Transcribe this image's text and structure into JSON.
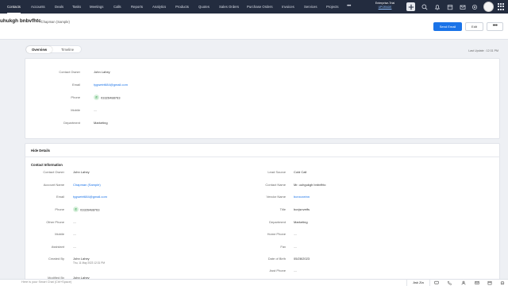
{
  "nav": {
    "tabs": [
      "Contacts",
      "Accounts",
      "Deals",
      "Tasks",
      "Meetings",
      "Calls",
      "Reports",
      "Analytics",
      "Products",
      "Quotes",
      "Sales Orders",
      "Purchase Orders",
      "Invoices",
      "Services",
      "Projects"
    ],
    "more": "•••",
    "plan_name": "Enterprise-Trial",
    "upgrade": "UPGRADE",
    "icons": [
      "plus-icon",
      "search-icon",
      "bell-icon",
      "calendar-icon",
      "mail-icon",
      "settings-icon",
      "gear-icon",
      "avatar",
      "apps-grid-icon"
    ]
  },
  "record": {
    "name": "uhukgh bnbvfhtc",
    "subtitle": "- Chapman (Sample)",
    "send_email": "Send Email",
    "edit": "Edit",
    "more": "•••"
  },
  "tabs": {
    "overview": "Overview",
    "timeline": "Timeline"
  },
  "last_update": "Last Update : 12:31 PM",
  "overview": {
    "fields": [
      {
        "label": "Contact Owner",
        "value": "John Lahey"
      },
      {
        "label": "Email",
        "value": "tygwetrt684@gmail.com"
      },
      {
        "label": "Phone",
        "value": "03326488763"
      },
      {
        "label": "Mobile",
        "value": "—"
      },
      {
        "label": "Department",
        "value": "Marketing"
      }
    ]
  },
  "details": {
    "hide_label": "Hide Details",
    "section_title": "Contact Information",
    "left": [
      {
        "label": "Contact Owner",
        "value": "John Lahey"
      },
      {
        "label": "Account Name",
        "value": "Chapman (Sample)"
      },
      {
        "label": "Email",
        "value": "tygwetrt684@gmail.com"
      },
      {
        "label": "Phone",
        "value": "03326488763"
      },
      {
        "label": "Other Phone",
        "value": "—"
      },
      {
        "label": "Mobile",
        "value": "—"
      },
      {
        "label": "Assistant",
        "value": "—"
      },
      {
        "label": "Created By",
        "value": "John Lahey",
        "sub": "Thu, 11 May 2023 12:31 PM"
      },
      {
        "label": "Modified By",
        "value": "John Lahey"
      }
    ],
    "right": [
      {
        "label": "Lead Source",
        "value": "Cold Call"
      },
      {
        "label": "Contact Name",
        "value": "Mr. uuhgukgh bnbvfhtc"
      },
      {
        "label": "Vendor Name",
        "value": "bcnxcxeinn"
      },
      {
        "label": "Title",
        "value": "bcnjsnvetfs"
      },
      {
        "label": "Department",
        "value": "Marketing"
      },
      {
        "label": "Home Phone",
        "value": "—"
      },
      {
        "label": "Fax",
        "value": "—"
      },
      {
        "label": "Date of Birth",
        "value": "05/28/2023"
      },
      {
        "label": "Asst Phone",
        "value": "—"
      }
    ]
  },
  "chat": {
    "placeholder": "Here is your Smart Chat (Ctrl+Space)",
    "ask_zia": "Ask Zia"
  }
}
